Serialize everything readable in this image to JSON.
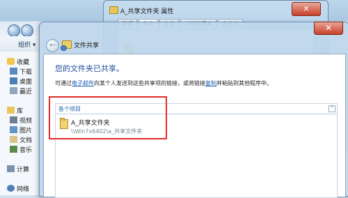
{
  "explorer": {
    "toolbar": {
      "organize_label": "组织 ▾"
    },
    "nav_items": [
      {
        "label": "收藏",
        "icon": "star-icon"
      },
      {
        "label": "下载",
        "icon": "download-folder-icon"
      },
      {
        "label": "桌面",
        "icon": "desktop-icon"
      },
      {
        "label": "最近",
        "icon": "recent-places-icon"
      },
      {
        "label": "库",
        "icon": "library-icon"
      },
      {
        "label": "视频",
        "icon": "video-library-icon"
      },
      {
        "label": "图片",
        "icon": "picture-library-icon"
      },
      {
        "label": "文档",
        "icon": "document-library-icon"
      },
      {
        "label": "音乐",
        "icon": "music-library-icon"
      },
      {
        "label": "计算",
        "icon": "computer-icon"
      },
      {
        "label": "网络",
        "icon": "network-icon"
      }
    ]
  },
  "properties_window": {
    "title": "A_共享文件夹 属性",
    "tabs": [
      "常规",
      "共享",
      "安全",
      "以前的版本",
      "自定义"
    ],
    "close_glyph": "✕"
  },
  "dialog": {
    "title": "文件共享",
    "close_glyph": "✕",
    "back_glyph": "←",
    "heading": "您的文件夹已共享。",
    "description": {
      "part1": "可通过",
      "link_email": "电子邮件",
      "part2": "向某个人发送到这些共享项的链接，或将链接",
      "link_copy": "复制",
      "part3": "并粘贴到其他程序中。"
    },
    "list": {
      "group_label": "各个项目",
      "collapse_glyph": "^",
      "items": [
        {
          "name": "A_共享文件夹",
          "path": "\\\\Win7x6402\\a_共享文件夹"
        }
      ]
    }
  },
  "colors": {
    "heading": "#1d4c9a",
    "link": "#1a5fb4",
    "highlight_box": "#e02a2a"
  }
}
